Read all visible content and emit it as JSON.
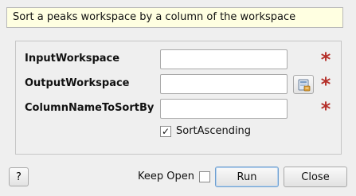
{
  "description": "Sort a peaks workspace by a column of the workspace",
  "properties": [
    {
      "label": "InputWorkspace",
      "value": "",
      "required": true,
      "has_browse": false
    },
    {
      "label": "OutputWorkspace",
      "value": "",
      "required": true,
      "has_browse": true
    },
    {
      "label": "ColumnNameToSortBy",
      "value": "",
      "required": true,
      "has_browse": false
    }
  ],
  "required_marker": "*",
  "sort_ascending": {
    "label": "SortAscending",
    "checked": true,
    "check_glyph": "✓"
  },
  "footer": {
    "help_label": "?",
    "keep_open_label": "Keep Open",
    "keep_open_checked": false,
    "run_label": "Run",
    "close_label": "Close"
  },
  "icons": {
    "browse": "workspace-browse-icon",
    "required": "required-star-icon"
  },
  "colors": {
    "required_star": "#b5302a",
    "description_bg": "#ffffe1",
    "run_focus_border": "#6e9fd0"
  }
}
